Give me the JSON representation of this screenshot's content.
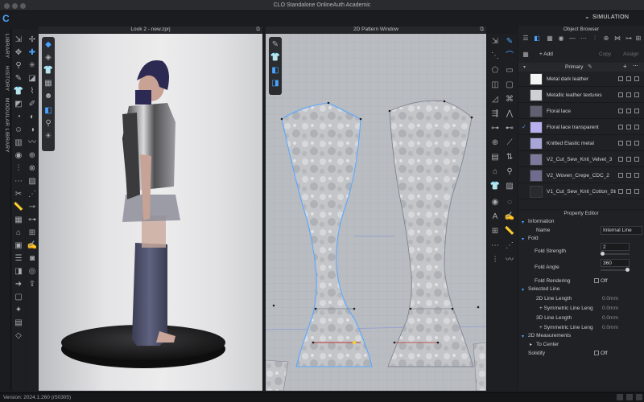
{
  "window": {
    "title": "CLO Standalone OnlineAuth Academic"
  },
  "header": {
    "simulation_label": "SIMULATION"
  },
  "left_tabs": [
    "LIBRARY",
    "HISTORY",
    "MODULAR LIBRARY"
  ],
  "view3d": {
    "title": "Look 2 - new.zprj"
  },
  "view2d": {
    "title": "2D Pattern Window"
  },
  "object_browser": {
    "title": "Object Browser",
    "add_label": "+ Add",
    "copy_label": "Copy",
    "assign_label": "Assign",
    "group_label": "Primary",
    "materials": [
      {
        "name": "Metal dark leather",
        "swatch": "#f4f4f5",
        "checked": false
      },
      {
        "name": "Metallic leather textures",
        "swatch": "#cfd0d3",
        "checked": false
      },
      {
        "name": "Floral lace",
        "swatch": "#5f6070",
        "checked": false
      },
      {
        "name": "Floral lace transparent",
        "swatch": "#b9b0f0",
        "checked": true
      },
      {
        "name": "Knitted Elastic metal",
        "swatch": "#a7a6d6",
        "checked": false
      },
      {
        "name": "V2_Cut_Sew_Knit_Velvet_3",
        "swatch": "#7b7a9a",
        "checked": false
      },
      {
        "name": "V2_Woven_Crepe_CDC_2",
        "swatch": "#6e6d8f",
        "checked": false
      },
      {
        "name": "V1_Cut_Sew_Knit_Cotton_Stretc",
        "swatch": "#2a2b2e",
        "checked": false
      }
    ]
  },
  "property_editor": {
    "title": "Property Editor",
    "sections": {
      "information": "Information",
      "fold": "Fold",
      "selected_line": "Selected Line",
      "measurements_2d": "2D Measurements"
    },
    "name_label": "Name",
    "name_value": "Internal Line",
    "fold_strength_label": "Fold Strength",
    "fold_strength_value": "2",
    "fold_strength_fraction": 0.02,
    "fold_angle_label": "Fold Angle",
    "fold_angle_value": "360",
    "fold_angle_fraction": 1.0,
    "fold_rendering_label": "Fold Rendering",
    "fold_rendering_value": "Off",
    "line2d_label": "2D Line Length",
    "line2d_value": "0.0mm",
    "sym2d_label": "+ Symmetric Line Leng",
    "sym2d_value": "0.0mm",
    "line3d_label": "3D Line Length",
    "line3d_value": "0.0mm",
    "sym3d_label": "+ Symmetric Line Leng",
    "sym3d_value": "0.0mm",
    "to_center_label": "To Center",
    "solidify_label": "Solidify",
    "solidify_value": "Off"
  },
  "statusbar": {
    "version": "Version: 2024.1.260 (r50305)"
  },
  "colors": {
    "accent": "#4aa3ff",
    "pattern_outline": "#5aa9ff",
    "viewport_2d": "#b9bcc1"
  }
}
